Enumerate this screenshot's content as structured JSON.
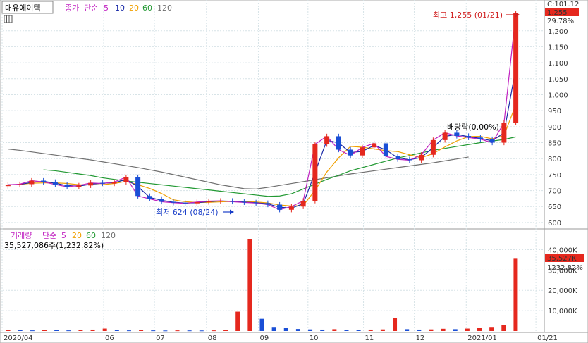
{
  "header": {
    "stock_name": "대유에이텍",
    "price_label": "종가",
    "ma_label": "단순",
    "ma_periods": [
      "5",
      "10",
      "20",
      "60",
      "120"
    ],
    "current_tag": "C:101.12",
    "price_tag": "1,255",
    "pct_tag": "29.78%"
  },
  "annotations": {
    "high": "최고 1,255 (01/21)",
    "low": "최저 624 (08/24)",
    "dividend": "배당락(0.00%)"
  },
  "volume_header": {
    "label": "거래량",
    "ma_label": "단순",
    "ma_periods": [
      "5",
      "20",
      "60",
      "120"
    ],
    "summary": "35,527,086주(1,232.82%)",
    "vol_tag": "35,527K",
    "vol_pct_tag": "1232.82%"
  },
  "colors": {
    "up": "#e5281e",
    "down": "#1a4fd6",
    "ma5": "#c020c0",
    "ma10": "#1a2ba8",
    "ma20": "#f0a000",
    "ma60": "#229933",
    "ma120": "#707070",
    "grid": "#d7e3e7"
  },
  "chart_data": [
    {
      "type": "candlestick",
      "title": "",
      "ylim": [
        580,
        1270
      ],
      "y_ticks": [
        600,
        650,
        700,
        750,
        800,
        850,
        900,
        950,
        1000,
        1050,
        1100,
        1150,
        1200
      ],
      "y_tick_labels": [
        "600",
        "650",
        "700",
        "750",
        "800",
        "850",
        "900",
        "950",
        "1,000",
        "1,050",
        "1,100",
        "1,150",
        "1,200"
      ],
      "x_ticks": [
        {
          "label": "2020/04",
          "week": 0
        },
        {
          "label": "06",
          "week": 8.6
        },
        {
          "label": "07",
          "week": 12.9
        },
        {
          "label": "08",
          "week": 17.3
        },
        {
          "label": "09",
          "week": 21.7
        },
        {
          "label": "10",
          "week": 25.9
        },
        {
          "label": "11",
          "week": 30.6
        },
        {
          "label": "12",
          "week": 34.9
        },
        {
          "label": "2021/01",
          "week": 39.3
        },
        {
          "label": "01/21",
          "week": 45.2
        }
      ],
      "weeks": 43,
      "close": [
        718,
        720,
        731,
        727,
        719,
        712,
        716,
        724,
        722,
        727,
        742,
        683,
        674,
        665,
        662,
        660,
        664,
        667,
        668,
        665,
        663,
        661,
        656,
        640,
        650,
        668,
        845,
        870,
        828,
        810,
        835,
        848,
        807,
        798,
        795,
        812,
        858,
        881,
        871,
        866,
        861,
        850,
        912,
        1255
      ],
      "ma60": [
        765,
        762,
        757,
        752,
        747,
        740,
        735,
        730,
        726,
        722,
        718,
        714,
        710,
        706,
        702,
        698,
        694,
        690,
        686,
        682,
        683,
        690,
        705,
        720,
        735,
        748,
        762,
        772,
        782,
        792,
        802,
        810,
        818,
        826,
        832,
        838,
        844,
        850,
        855,
        860,
        868
      ],
      "ma120": [
        830,
        826,
        821,
        816,
        811,
        806,
        801,
        796,
        790,
        784,
        778,
        772,
        765,
        758,
        750,
        742,
        734,
        726,
        718,
        712,
        706,
        705,
        710,
        716,
        722,
        728,
        734,
        740,
        746,
        752,
        757,
        762,
        767,
        772,
        777,
        782,
        787,
        793,
        799,
        805
      ],
      "high_label_value": 1255,
      "low_label_value": 624
    },
    {
      "type": "bar",
      "title": "",
      "ylabel": "",
      "ylim": [
        0,
        45000
      ],
      "y_ticks": [
        10000,
        20000,
        30000,
        40000
      ],
      "y_tick_labels": [
        "10,000K",
        "20,000K",
        "30,000K",
        "40,000K"
      ],
      "values_k": [
        500,
        400,
        300,
        600,
        350,
        300,
        400,
        700,
        1200,
        400,
        300,
        350,
        300,
        250,
        300,
        280,
        260,
        300,
        400,
        9500,
        45000,
        6000,
        2000,
        1500,
        1000,
        800,
        700,
        900,
        600,
        500,
        700,
        800,
        6500,
        900,
        700,
        800,
        1100,
        900,
        1200,
        1600,
        2000,
        2800,
        35527
      ]
    }
  ]
}
